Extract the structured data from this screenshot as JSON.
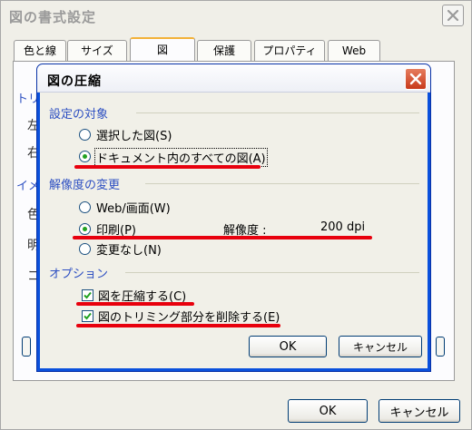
{
  "outer_dialog": {
    "title": "図の書式設定",
    "close_icon": "close-icon",
    "tabs": [
      {
        "label": "色と線",
        "active": false
      },
      {
        "label": "サイズ",
        "active": false
      },
      {
        "label": "図",
        "active": true
      },
      {
        "label": "保護",
        "active": false
      },
      {
        "label": "プロパティ",
        "active": false
      },
      {
        "label": "Web",
        "active": false
      }
    ],
    "background_text": {
      "group_trim_fragment": "トリ",
      "label_left": "左",
      "label_right": "右",
      "group_image_fragment": "イメ",
      "label_color": "色",
      "label_brightness": "明",
      "label_contrast": "コ"
    },
    "ok_label": "OK",
    "cancel_label": "キャンセル"
  },
  "compress_dialog": {
    "title": "図の圧縮",
    "close_icon": "close-icon",
    "target_group": {
      "label": "設定の対象",
      "options": [
        {
          "label": "選択した図(S)",
          "checked": false
        },
        {
          "label": "ドキュメント内のすべての図(A)",
          "checked": true
        }
      ]
    },
    "resolution_group": {
      "label": "解像度の変更",
      "options": [
        {
          "label": "Web/画面(W)",
          "checked": false
        },
        {
          "label": "印刷(P)",
          "checked": true
        },
        {
          "label": "変更なし(N)",
          "checked": false
        }
      ],
      "resolution_label": "解像度 :",
      "resolution_value": "200 dpi"
    },
    "options_group": {
      "label": "オプション",
      "checkboxes": [
        {
          "label": "図を圧縮する(C)",
          "checked": true
        },
        {
          "label": "図のトリミング部分を削除する(E)",
          "checked": true
        }
      ]
    },
    "ok_label": "OK",
    "cancel_label": "キャンセル"
  },
  "colors": {
    "titlebar_blue": "#0a50dc",
    "group_label_blue": "#2d4fc2",
    "annotation_red": "#e8000d",
    "check_green": "#21a121",
    "close_button_red": "#d54d2b",
    "active_tab_accent": "#f3b238"
  }
}
